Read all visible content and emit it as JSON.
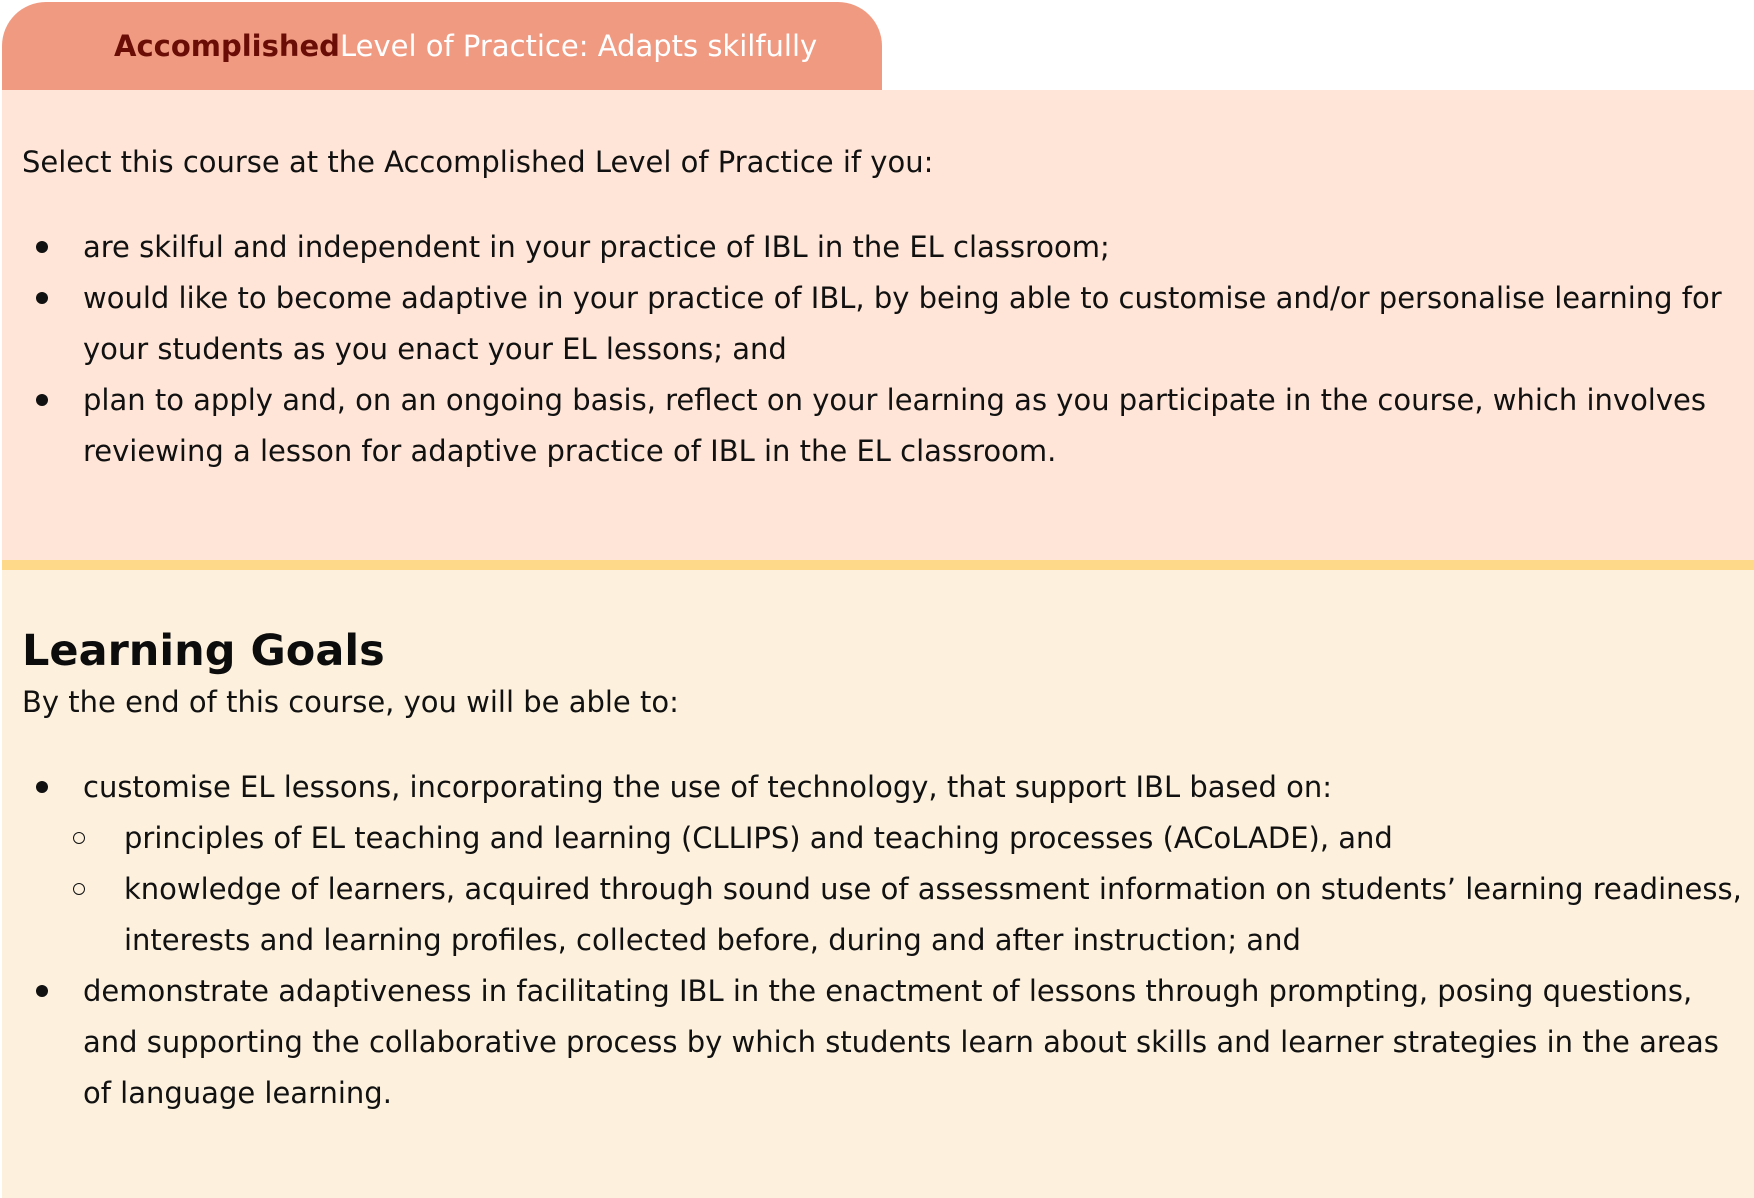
{
  "tab": {
    "level_name": "Accomplished",
    "level_rest": " Level of Practice: Adapts skilfully"
  },
  "accomplished": {
    "intro": "Select this course at the Accomplished Level of Practice if you:",
    "items": [
      "are skilful and independent in your practice of IBL in the EL classroom;",
      "would like to become adaptive in your practice of IBL, by being able to customise and/or personalise learning for your students as you enact your EL lessons; and",
      "plan to apply and, on an ongoing basis, reflect on your learning as you participate in the course, which involves reviewing a lesson for adaptive practice of IBL in the EL classroom."
    ]
  },
  "goals": {
    "heading": "Learning Goals",
    "intro": "By the end of this course, you will be able to:",
    "item1": "customise EL lessons, incorporating the use of technology, that support IBL based on:",
    "sub_items": [
      "principles of EL teaching and learning (CLLIPS) and teaching processes (ACoLADE), and",
      "knowledge of learners, acquired through sound use of assessment information on students’ learning readiness, interests and learning profiles, collected before, during and after instruction; and"
    ],
    "item2": "demonstrate adaptiveness in facilitating IBL in the enactment of lessons through prompting, posing questions, and supporting the collaborative process by which students learn about skills and learner strategies in the areas of language learning."
  },
  "colors": {
    "tab_bg": "#f09a82",
    "tab_strong": "#6a0d06",
    "panel_accomplished": "#fee5d7",
    "divider": "#ffd98a",
    "panel_goals": "#fdf1de"
  }
}
